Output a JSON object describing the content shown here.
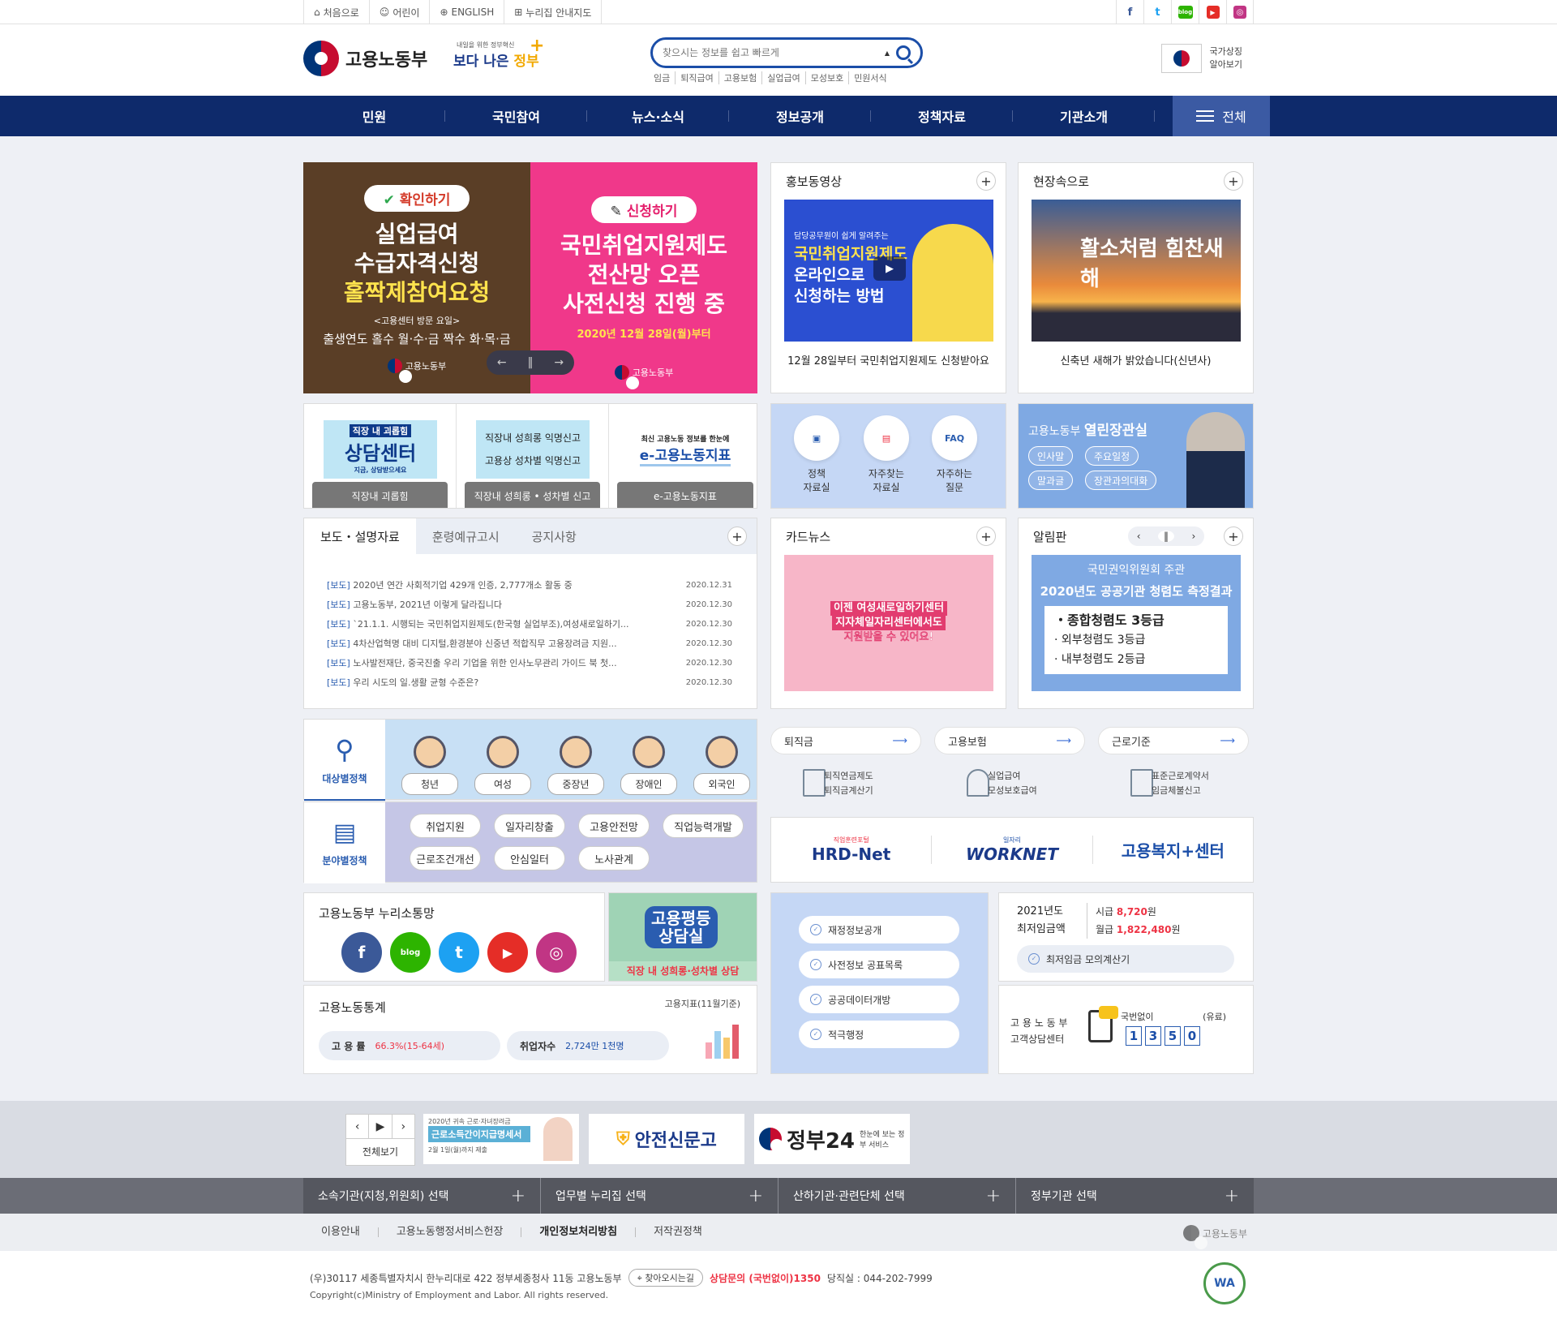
{
  "topbar": {
    "links": [
      "처음으로",
      "어린이",
      "ENGLISH",
      "누리집 안내지도"
    ],
    "sns": [
      "f",
      "t",
      "blog",
      "▶",
      "◎"
    ]
  },
  "header": {
    "logo": "고용노동부",
    "slogan_small": "내일을 위한 정부혁신",
    "slogan_main": "보다 나은",
    "slogan_accent": "정부",
    "search_placeholder": "찾으시는 정보를 쉽고 빠르게",
    "keywords": [
      "임금",
      "퇴직급여",
      "고용보험",
      "실업급여",
      "모성보호",
      "민원서식"
    ],
    "symbol_line1": "국가상징",
    "symbol_line2": "알아보기"
  },
  "gnb": {
    "items": [
      "민원",
      "국민참여",
      "뉴스·소식",
      "정보공개",
      "정책자료",
      "기관소개"
    ],
    "all": "전체"
  },
  "slides": {
    "a_pill": "확인하기",
    "a_line1": "실업급여",
    "a_line2": "수급자격신청",
    "a_line3": "홀짝제참여요청",
    "a_visit": "<고용센터 방문 요일>",
    "a_odd": "출생연도 홀수 월·수·금",
    "a_even": "짝수 화·목·금",
    "b_pill": "신청하기",
    "b_line1": "국민취업지원제도",
    "b_line2": "전산망 오픈",
    "b_line3": "사전신청 진행 중",
    "b_date": "2020년 12월 28일(월)부터",
    "org": "고용노동부"
  },
  "video": {
    "title": "홍보동영상",
    "thumb_small": "담당공무원이 쉽게 알려주는",
    "thumb_big1": "국민취업지원제도",
    "thumb_big2": "온라인으로",
    "thumb_big3": "신청하는 방법",
    "caption": "12월 28일부터 국민취업지원제도 신청받아요"
  },
  "field": {
    "title": "현장속으로",
    "thumb_text": "활소처럼 힘찬새해",
    "caption": "신축년 새해가 밝았습니다(신년사)"
  },
  "quick": [
    {
      "top": "직장 내 괴롭힘",
      "big": "상담센터",
      "small": "지금, 상담받으세요",
      "label": "직장내 괴롭힘"
    },
    {
      "top": "직장내 성희롱 익명신고",
      "big": "고용상 성차별 익명신고",
      "small": "",
      "label": "직장내 성희롱 • 성차별 신고"
    },
    {
      "top": "최신 고용노동 정보를 한눈에",
      "big": "e-고용노동지표",
      "small": "",
      "label": "e-고용노동지표"
    }
  ],
  "resources": [
    {
      "icon": "▣",
      "label1": "정책",
      "label2": "자료실"
    },
    {
      "icon": "▤",
      "label1": "자주찾는",
      "label2": "자료실"
    },
    {
      "icon": "FAQ",
      "label1": "자주하는",
      "label2": "질문"
    }
  ],
  "minister": {
    "title1": "고용노동부",
    "title2": "열린장관실",
    "buttons": [
      "인사말",
      "주요일정",
      "말과글",
      "장관과의대화"
    ]
  },
  "newsbox": {
    "tabs": [
      "보도・설명자료",
      "훈령예규고시",
      "공지사항"
    ],
    "items": [
      {
        "tag": "[보도]",
        "title": "2020년 연간 사회적기업 429개 인증, 2,777개소 활동 중",
        "date": "2020.12.31"
      },
      {
        "tag": "[보도]",
        "title": "고용노동부, 2021년 이렇게 달라집니다",
        "date": "2020.12.30"
      },
      {
        "tag": "[보도]",
        "title": "`21.1.1. 시행되는 국민취업지원제도(한국형 실업부조),여성새로일하기...",
        "date": "2020.12.30"
      },
      {
        "tag": "[보도]",
        "title": "4차산업혁명 대비 디지털,환경분야 신중년 적합직무 고용장려금 지원...",
        "date": "2020.12.30"
      },
      {
        "tag": "[보도]",
        "title": "노사발전재단, 중국진출 우리 기업을 위한 인사노무관리 가이드 북 첫...",
        "date": "2020.12.30"
      },
      {
        "tag": "[보도]",
        "title": "우리 시도의 일.생활 균형 수준은?",
        "date": "2020.12.30"
      }
    ]
  },
  "cardnews": {
    "title": "카드뉴스",
    "text1": "이젠 여성새로일하기센터",
    "text2": "지자체일자리센터에서도",
    "text3": "지원받을 수 있어요!"
  },
  "notice": {
    "title": "알림판",
    "org": "국민권익위원회 주관",
    "headline": "2020년도 공공기관 청렴도 측정결과",
    "r1": "・종합청렴도 3등급",
    "r2": "· 외부청렴도 3등급",
    "r3": "· 내부청렴도 2등급"
  },
  "target": {
    "label": "대상별정책",
    "people": [
      "청년",
      "여성",
      "중장년",
      "장애인",
      "외국인"
    ]
  },
  "field_policy": {
    "label": "분야별정책",
    "buttons": [
      "취업지원",
      "일자리창출",
      "고용안전망",
      "직업능력개발",
      "근로조건개선",
      "안심일터",
      "노사관계"
    ]
  },
  "services": [
    {
      "head": "퇴직금",
      "sub1": "퇴직연금제도",
      "sub2": "퇴직금계산기"
    },
    {
      "head": "고용보험",
      "sub1": "실업급여",
      "sub2": "모성보호급여"
    },
    {
      "head": "근로기준",
      "sub1": "표준근로계약서",
      "sub2": "임금체불신고"
    }
  ],
  "portals": {
    "hrd_small": "직업훈련포털",
    "hrd": "HRD-Net",
    "work_small": "일자리",
    "work": "WORKNET",
    "welfare": "고용복지+센터"
  },
  "sns_box": {
    "title": "고용노동부 누리소통망",
    "icons": [
      "f",
      "blog",
      "t",
      "▶",
      "◎"
    ]
  },
  "equality": {
    "line1": "고용평등",
    "line2": "상담실",
    "sub": "직장 내 성희롱·성차별 상담"
  },
  "stats": {
    "title": "고용노동통계",
    "basis": "고용지표(11월기준)",
    "rate_label": "고 용 률",
    "rate_value": "66.3%(15-64세)",
    "emp_label": "취업자수",
    "emp_value": "2,724만 1천명"
  },
  "open": {
    "buttons": [
      "재정정보공개",
      "사전정보 공표목록",
      "공공데이터개방",
      "적극행정"
    ]
  },
  "wage": {
    "year": "2021년도",
    "label": "최저임금액",
    "hour_label": "시급",
    "hour": "8,720",
    "month_label": "월급",
    "month": "1,822,480",
    "unit": "원",
    "calc": "최저임금 모의계산기"
  },
  "callcenter": {
    "name1": "고 용 노 동 부",
    "name2": "고객상담센터",
    "note": "국번없이",
    "paid": "(유료)",
    "digits": [
      "1",
      "3",
      "5",
      "0"
    ]
  },
  "banners": {
    "all": "전체보기",
    "b1_small": "2020년 귀속 근로·자녀장려금",
    "b1": "근로소득간이지급명세서",
    "b1_sub": "2월 1일(월)까지 제출",
    "b2": "안전신문고",
    "b3": "정부24",
    "b3_sub": "한눈에 보는 정부 서비스"
  },
  "sitelinks": [
    "소속기관(지청,위원회) 선택",
    "업무별 누리집 선택",
    "산하기관·관련단체 선택",
    "정부기관 선택"
  ],
  "footmenu": [
    "이용안내",
    "고용노동행정서비스헌장",
    "개인정보처리방침",
    "저작권정책"
  ],
  "footer": {
    "address": "(우)30117 세종특별자치시 한누리대로 422 정부세종청사 11동 고용노동부",
    "directions": "찾아오시는길",
    "consult": "상담문의 (국번없이)1350",
    "duty": "당직실 : 044-202-7999",
    "copyright": "Copyright(c)Ministry of Employment and Labor. All rights reserved.",
    "logo": "고용노동부",
    "wa": "WA"
  }
}
